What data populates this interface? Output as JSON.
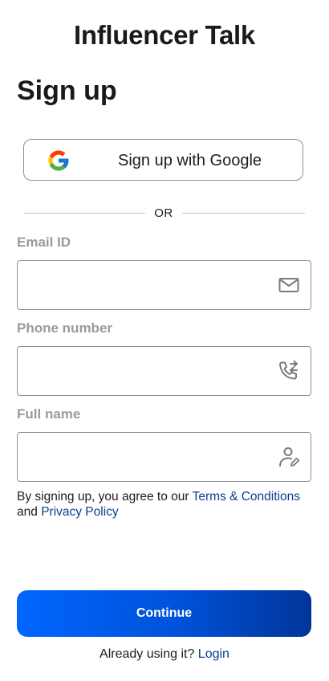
{
  "app": {
    "title": "Influencer Talk"
  },
  "page": {
    "heading": "Sign up"
  },
  "google_button": {
    "label": "Sign up with Google",
    "icon": "google-icon"
  },
  "divider": {
    "text": "OR"
  },
  "fields": {
    "email": {
      "label": "Email ID",
      "value": "",
      "placeholder": "",
      "icon": "mail-icon"
    },
    "phone": {
      "label": "Phone number",
      "value": "",
      "placeholder": "",
      "icon": "phone-forward-icon"
    },
    "full_name": {
      "label": "Full name",
      "value": "",
      "placeholder": "",
      "icon": "user-edit-icon"
    }
  },
  "agreement": {
    "prefix": "By signing up, you agree to our",
    "terms_link": "Terms & Conditions",
    "conjunction": "and",
    "privacy_link": "Privacy Policy"
  },
  "continue_button": {
    "label": "Continue"
  },
  "footer": {
    "prompt": "Already using it?",
    "login_link": "Login"
  },
  "colors": {
    "primary_gradient_start": "#0066ff",
    "primary_gradient_end": "#00359a",
    "link": "#0a3d8f",
    "label_gray": "#9a9a9f",
    "border": "#8e8e93"
  }
}
